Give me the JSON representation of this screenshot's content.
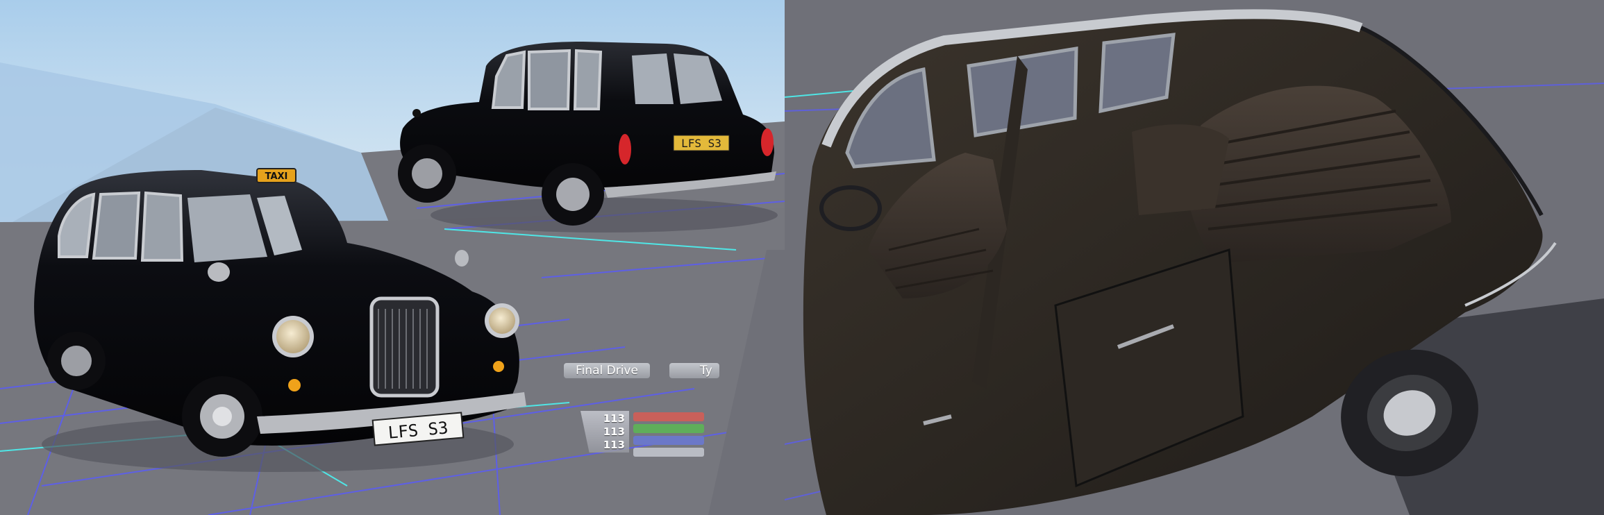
{
  "vehicle": {
    "front_plate": "LFS S3",
    "rear_plate": "LFS S3",
    "roof_sign": "TAXI"
  },
  "hud": {
    "tabs": [
      {
        "label": "Final Drive"
      },
      {
        "label": "Ty"
      }
    ],
    "values": [
      "113",
      "113",
      "113"
    ],
    "bar_colors": [
      "#c9605a",
      "#5fae5a",
      "#6b78c8",
      "#b9bcc4"
    ]
  },
  "colors": {
    "body_paint": "#0b0c10",
    "plate_front": "#f4f4f2",
    "plate_rear": "#e3b93a",
    "grid_line": "#5a5cf0",
    "grid_highlight": "#4fe6e6",
    "sky": "#b8d6ee",
    "ground": "#77787f"
  }
}
